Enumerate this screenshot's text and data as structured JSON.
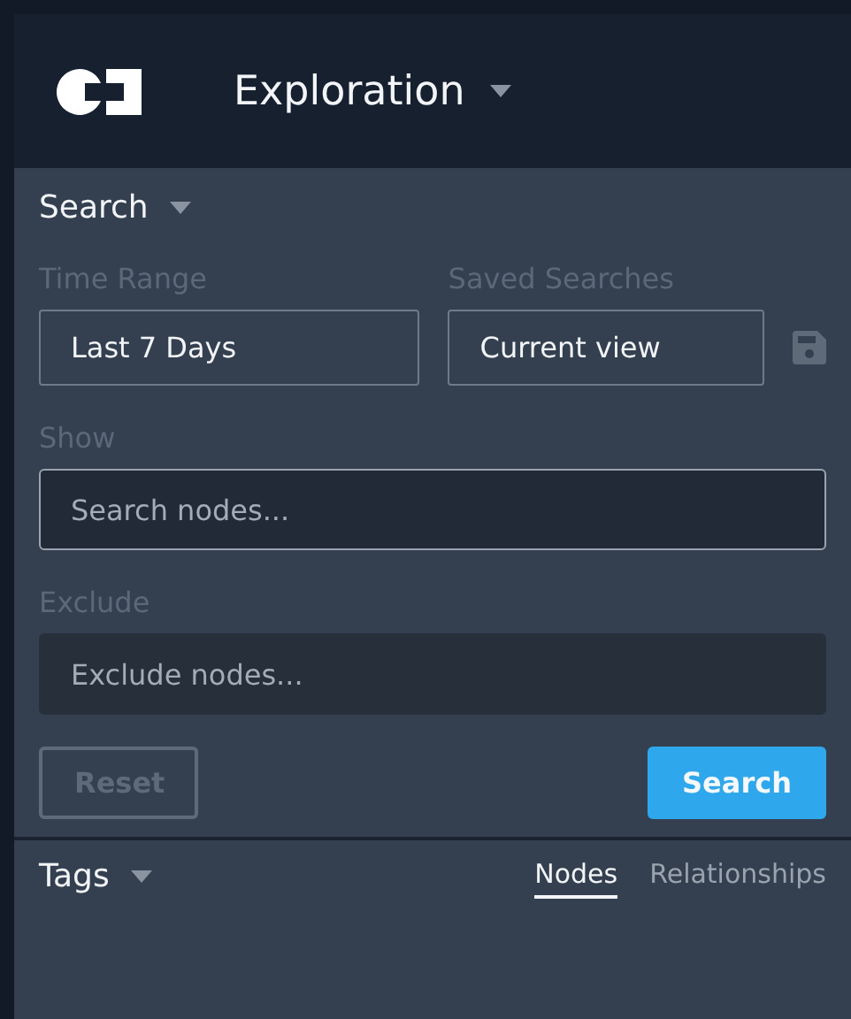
{
  "header": {
    "title": "Exploration"
  },
  "search_panel": {
    "title": "Search",
    "time_range": {
      "label": "Time Range",
      "value": "Last 7 Days"
    },
    "saved_searches": {
      "label": "Saved Searches",
      "value": "Current view"
    },
    "show": {
      "label": "Show",
      "placeholder": "Search nodes..."
    },
    "exclude": {
      "label": "Exclude",
      "placeholder": "Exclude nodes..."
    },
    "buttons": [
      {
        "label": "Reset",
        "kind": "secondary",
        "disabled": true
      },
      {
        "label": "Search",
        "kind": "primary",
        "disabled": false
      }
    ]
  },
  "tags_panel": {
    "title": "Tags",
    "tabs": [
      {
        "label": "Nodes",
        "selected": true
      },
      {
        "label": "Relationships",
        "selected": false
      }
    ]
  }
}
